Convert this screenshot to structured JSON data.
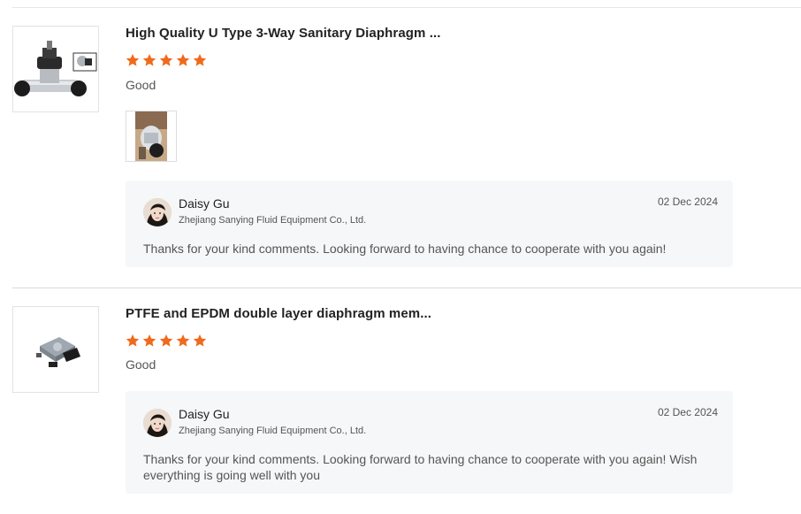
{
  "reviews": [
    {
      "product_title": "High Quality U Type 3-Way Sanitary Diaphragm ...",
      "rating": 5,
      "rating_text": "Good",
      "has_photo": true,
      "reply": {
        "name": "Daisy Gu",
        "company": "Zhejiang Sanying Fluid Equipment Co., Ltd.",
        "date": "02 Dec 2024",
        "text": "Thanks for your kind comments. Looking forward to having chance to cooperate with you again!"
      }
    },
    {
      "product_title": "PTFE and EPDM double layer diaphragm mem...",
      "rating": 5,
      "rating_text": "Good",
      "has_photo": false,
      "reply": {
        "name": "Daisy Gu",
        "company": "Zhejiang Sanying Fluid Equipment Co., Ltd.",
        "date": "02 Dec 2024",
        "text": "Thanks for your kind comments. Looking forward to having chance to cooperate with you again! Wish everything is going well with you"
      }
    }
  ],
  "colors": {
    "star": "#f06a1b",
    "reply_bg": "#f6f7f8",
    "divider": "#e6e6e6"
  },
  "icons": {
    "star": "star-icon"
  }
}
